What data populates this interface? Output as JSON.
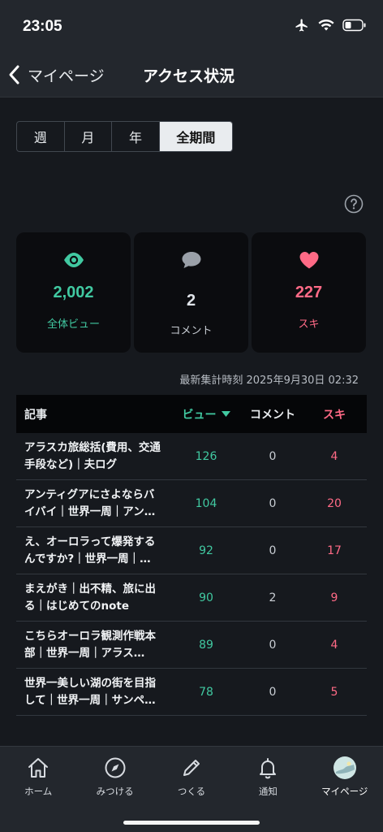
{
  "status_bar": {
    "time": "23:05"
  },
  "nav": {
    "back_label": "マイページ",
    "title": "アクセス状況"
  },
  "period_tabs": [
    "週",
    "月",
    "年",
    "全期間"
  ],
  "selected_period": "全期間",
  "stats": {
    "views": {
      "value": "2,002",
      "label": "全体ビュー"
    },
    "comments": {
      "value": "2",
      "label": "コメント"
    },
    "suki": {
      "value": "227",
      "label": "スキ"
    }
  },
  "updated_at": "最新集計時刻 2025年9月30日 02:32",
  "table": {
    "headers": {
      "article": "記事",
      "view": "ビュー",
      "comment": "コメント",
      "suki": "スキ"
    },
    "rows": [
      {
        "title": "アラスカ旅総括(費用、交通手段など)｜夫ログ",
        "views": "126",
        "comments": "0",
        "suki": "4"
      },
      {
        "title": "アンティグアにさよならバイバイ｜世界一周｜アン…",
        "views": "104",
        "comments": "0",
        "suki": "20"
      },
      {
        "title": "え、オーロラって爆発するんですか?｜世界一周｜…",
        "views": "92",
        "comments": "0",
        "suki": "17"
      },
      {
        "title": "まえがき｜出不精、旅に出る｜はじめてのnote",
        "views": "90",
        "comments": "2",
        "suki": "9"
      },
      {
        "title": "こちらオーロラ観測作戦本部｜世界一周｜アラス…",
        "views": "89",
        "comments": "0",
        "suki": "4"
      },
      {
        "title": "世界一美しい湖の街を目指して｜世界一周｜サンペ…",
        "views": "78",
        "comments": "0",
        "suki": "5"
      }
    ]
  },
  "tab_bar": {
    "items": [
      {
        "label": "ホーム",
        "icon": "home-icon"
      },
      {
        "label": "みつける",
        "icon": "compass-icon"
      },
      {
        "label": "つくる",
        "icon": "pencil-icon"
      },
      {
        "label": "通知",
        "icon": "bell-icon"
      },
      {
        "label": "マイページ",
        "icon": "avatar"
      }
    ],
    "active": "マイページ"
  },
  "colors": {
    "view": "#41c9a1",
    "suki": "#ff6a86",
    "comment": "#c9ced4",
    "background": "#16191e"
  }
}
